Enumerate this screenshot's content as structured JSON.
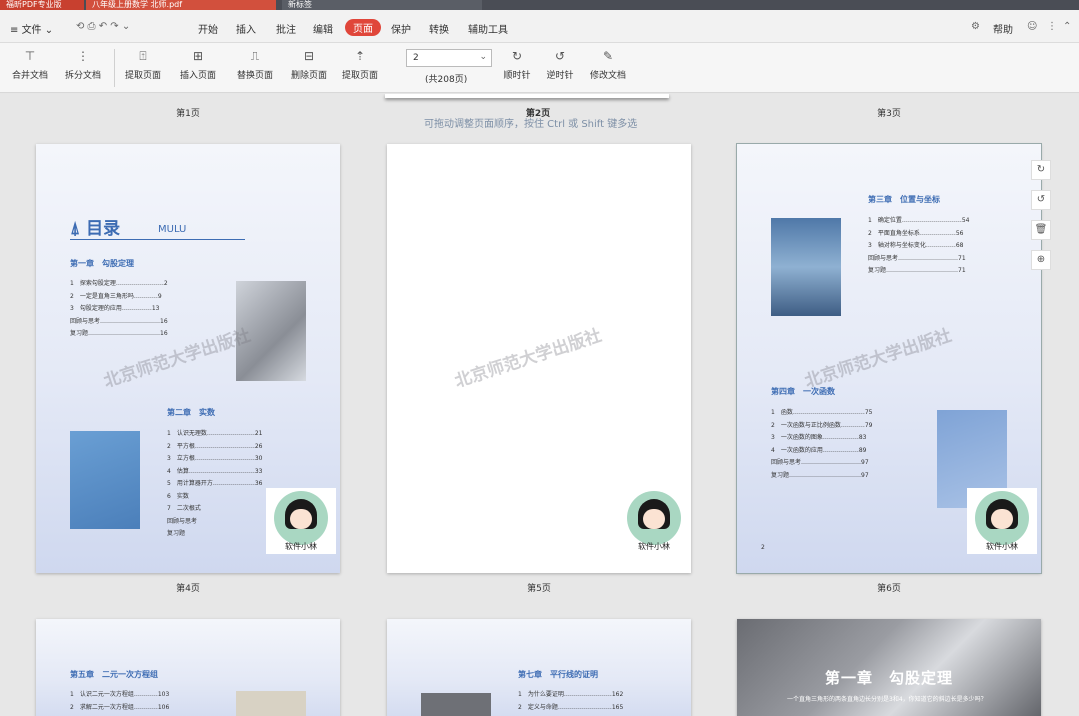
{
  "window": {
    "tabs": [
      "福昕PDF专业版",
      "八年级上册数学 北师.pdf",
      "新标签"
    ],
    "window_controls": [
      "—",
      "□",
      "×"
    ]
  },
  "menu": {
    "items": [
      "文件",
      "开始",
      "插入",
      "批注",
      "编辑",
      "页面",
      "保护",
      "转换",
      "辅助工具"
    ],
    "active": "页面",
    "right": "帮助"
  },
  "ribbon": {
    "buttons": [
      "合并文档",
      "拆分文档",
      "提取页面",
      "插入页面",
      "替换页面",
      "删除页面",
      "提取页面",
      "顺时针",
      "逆时针",
      "修改文档"
    ],
    "page_value": "2",
    "page_total": "(共208页)"
  },
  "hint": "可拖动调整页面顺序，按住 Ctrl 或 Shift 键多选",
  "pages": {
    "top_labels": [
      "第1页",
      "第2页",
      "第3页"
    ],
    "mid_labels": [
      "第4页",
      "第5页",
      "第6页"
    ],
    "watermark": "北京师范大学出版社",
    "avatar_caption": "软件小林",
    "p4": {
      "title": "目录",
      "title_en": "MULU",
      "ch1": "第一章　勾股定理",
      "ch1_items": [
        "1　探索勾股定理……………………2",
        "2　一定是直角三角形吗…………9",
        "3　勾股定理的应用……………13",
        "回顾与思考…………………………16",
        "复习题………………………………16"
      ],
      "ch2": "第二章　实数",
      "ch2_items": [
        "1　认识无理数……………………21",
        "2　平方根…………………………26",
        "3　立方根…………………………30",
        "4　估算……………………………33",
        "5　用计算器开方…………………36",
        "6　实数",
        "7　二次根式",
        "回顾与思考",
        "复习题"
      ]
    },
    "p6": {
      "ch3": "第三章　位置与坐标",
      "ch3_items": [
        "1　确定位置…………………………54",
        "2　平面直角坐标系………………56",
        "3　轴对称与坐标变化……………68",
        "回顾与思考…………………………71",
        "复习题………………………………71"
      ],
      "ch4": "第四章　一次函数",
      "ch4_items": [
        "1　函数………………………………75",
        "2　一次函数与正比例函数…………79",
        "3　一次函数的图象………………83",
        "4　一次函数的应用………………89",
        "回顾与思考…………………………97",
        "复习题………………………………97"
      ],
      "page_no": "2"
    },
    "p7": {
      "ch5": "第五章　二元一次方程组",
      "ch5_items": [
        "1　认识二元一次方程组…………103",
        "2　求解二元一次方程组…………106"
      ]
    },
    "p8": {
      "ch7": "第七章　平行线的证明",
      "ch7_items": [
        "1　为什么要证明……………………162",
        "2　定义与命题………………………165"
      ]
    },
    "p9": {
      "title": "第一章　勾股定理",
      "body": "一个直角三角形的两条直角边长分别是3和4，你知道它的斜边长是多少吗？"
    }
  },
  "side_tools": [
    "↻",
    "↺",
    "🗑",
    "⊕"
  ],
  "colors": {
    "accent": "#e0463a",
    "heading": "#3d6cb3"
  }
}
